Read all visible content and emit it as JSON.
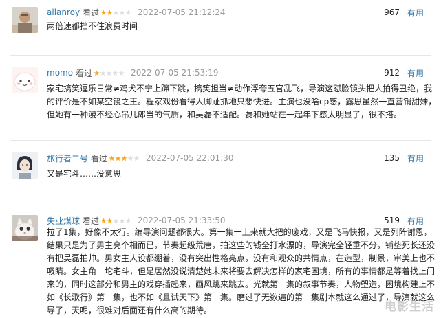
{
  "comments": [
    {
      "username": "allanroy",
      "status": "看过",
      "rating": 2,
      "time": "2022-07-05 21:12:24",
      "votes": "967",
      "useful_label": "有用",
      "avatar_icon": "avatar-photo-person-icon",
      "lines": [
        "两倍速都挡不住浪费时间"
      ]
    },
    {
      "username": "momo",
      "status": "看过",
      "rating": 1,
      "time": "2022-07-05 21:53:19",
      "votes": "912",
      "useful_label": "有用",
      "avatar_icon": "avatar-cartoon-face-icon",
      "lines": [
        "家宅搞笑逗乐日常≠鸡犬不宁上蹿下跳，搞笑担当≠动作浮夸五官乱飞，导演这怼脸镜头把人拍得丑绝，我",
        "的评价是不如某空镜之王。程家戏份看得人脚趾抓地只想快进。主演也没啥cp感，露思虽然一直营销甜妹，",
        "但她有一种漫不经心吊儿郎当的气质，和吴磊不适配。磊和她站在一起年下感太明显了，很不搭。"
      ]
    },
    {
      "username": "旅行者二号",
      "status": "看过",
      "rating": 3,
      "time": "2022-07-05 22:01:30",
      "votes": "135",
      "useful_label": "有用",
      "avatar_icon": "avatar-illustrated-character-icon",
      "lines": [
        "又是宅斗……没意思"
      ]
    },
    {
      "username": "失业煤球",
      "status": "看过",
      "rating": 2,
      "time": "2022-07-05 21:33:50",
      "votes": "519",
      "useful_label": "有用",
      "avatar_icon": "avatar-cat-photo-icon",
      "lines": [
        "拉了1集，好像不太行。编导演问题都很大。第一集一上来就大把的废戏，又是飞马快报，又是列阵谢恩，",
        "结果只是为了男主亮个相而已，节奏超级荒唐，拍这些的钱全打水漂的，导演完全轻重不分，铺垫死长还没",
        "有把吴磊拍帅。男女主人设都绷着，没有突出性格亮点，没有和观众的共情点，在造型，制景，审美上也不",
        "吸睛。女主角一坨宅斗，但是居然没说清楚她未来将要去解决怎样的家宅困境，所有的事情都是等着找上门",
        "来的，同时这部分和男主的戏穿插起来，画风跳来跳去。光就第一集的叙事节奏，人物塑造，困境构建上不",
        "如《长歌行》第一集，也不如《且试天下》第一集。磨过了无数遍的第一集剧本就这么通过了，导演就这么",
        "导了，天呢，很难对后面还有什么高的期待。"
      ]
    }
  ],
  "watermark": "电影生活",
  "colors": {
    "link_blue": "#3377aa",
    "star_filled": "#f5a623",
    "star_empty": "#dddddd",
    "time_gray": "#999999",
    "separator": "#e6e6e6"
  }
}
